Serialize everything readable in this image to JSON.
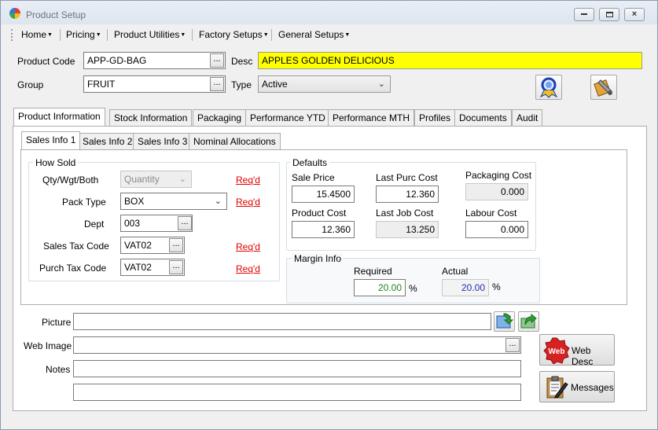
{
  "window": {
    "title": "Product Setup",
    "min": "0",
    "max": "1",
    "close": "r"
  },
  "menu": [
    {
      "label": "Home"
    },
    {
      "label": "Pricing"
    },
    {
      "label": "Product Utilities"
    },
    {
      "label": "Factory Setups"
    },
    {
      "label": "General Setups"
    }
  ],
  "header": {
    "product_code_label": "Product Code",
    "product_code": "APP-GD-BAG",
    "desc_label": "Desc",
    "desc": "APPLES GOLDEN DELICIOUS",
    "group_label": "Group",
    "group": "FRUIT",
    "type_label": "Type",
    "type": "Active",
    "ellipsis": "..."
  },
  "tabs": [
    "Product Information",
    "Stock Information",
    "Packaging",
    "Performance YTD",
    "Performance MTH",
    "Profiles",
    "Documents",
    "Audit"
  ],
  "subtabs": [
    "Sales Info 1",
    "Sales Info 2",
    "Sales Info 3",
    "Nominal Allocations"
  ],
  "how_sold": {
    "title": "How Sold",
    "qty_label": "Qty/Wgt/Both",
    "qty_value": "Quantity",
    "pack_label": "Pack Type",
    "pack_value": "BOX",
    "dept_label": "Dept",
    "dept_value": "003",
    "sales_tax_label": "Sales Tax Code",
    "sales_tax_value": "VAT02",
    "purch_tax_label": "Purch Tax Code",
    "purch_tax_value": "VAT02",
    "reqd": "Req'd"
  },
  "defaults": {
    "title": "Defaults",
    "sale_price_label": "Sale Price",
    "sale_price": "15.4500",
    "last_purc_label": "Last Purc Cost",
    "last_purc": "12.360",
    "packaging_label": "Packaging Cost",
    "packaging": "0.000",
    "product_cost_label": "Product Cost",
    "product_cost": "12.360",
    "last_job_label": "Last Job Cost",
    "last_job": "13.250",
    "labour_label": "Labour Cost",
    "labour": "0.000"
  },
  "margin": {
    "title": "Margin Info",
    "required_label": "Required",
    "required": "20.00",
    "actual_label": "Actual",
    "actual": "20.00",
    "pct": "%"
  },
  "bottom": {
    "picture_label": "Picture",
    "picture": "",
    "web_image_label": "Web Image",
    "web_image": "",
    "notes_label": "Notes",
    "notes1": "",
    "notes2": "",
    "web_desc_label": "Web Desc",
    "web_badge": "Web",
    "messages_label": "Messages"
  }
}
